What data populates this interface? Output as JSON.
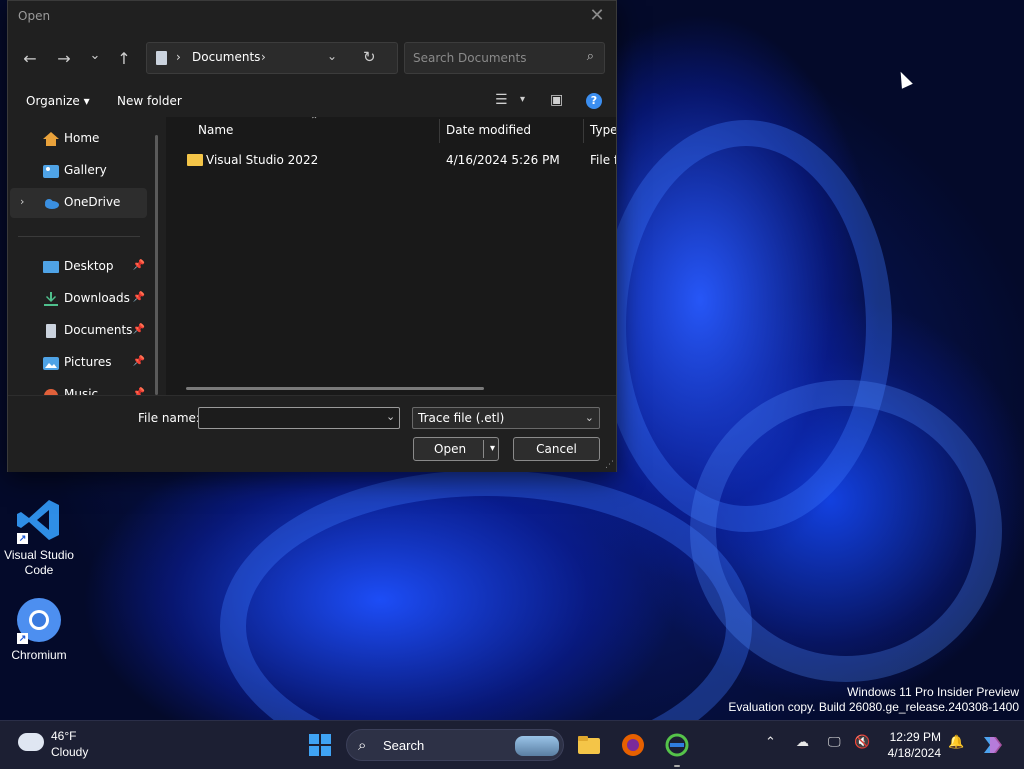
{
  "dialog": {
    "title": "Open",
    "close_glyph": "✕",
    "nav": {
      "back_glyph": "←",
      "forward_glyph": "→",
      "recent_glyph": "⌄",
      "up_glyph": "↑"
    },
    "address": {
      "crumb": "Documents",
      "sep_glyph": "›",
      "dd_glyph": "⌄",
      "refresh_glyph": "↻"
    },
    "search": {
      "placeholder": "Search Documents",
      "icon_glyph": "⌕"
    },
    "commands": {
      "organize": "Organize ▾",
      "new_folder": "New folder",
      "view_glyph": "☰",
      "view_dd_glyph": "▾",
      "preview_glyph": "▣",
      "help_glyph": "?"
    },
    "nav_pane": {
      "items": [
        {
          "label": "Home",
          "icon": "home-icon",
          "color": "#e9a23b"
        },
        {
          "label": "Gallery",
          "icon": "gallery-icon",
          "color": "#4fa3e6"
        },
        {
          "label": "OneDrive",
          "icon": "cloud-icon",
          "color": "#3a8fe0",
          "selected": true,
          "expand_glyph": "›"
        },
        {
          "label": "Desktop",
          "icon": "desktop-icon",
          "color": "#4fa3e6",
          "pin": "📌"
        },
        {
          "label": "Downloads",
          "icon": "download-icon",
          "color": "#4fc08d",
          "pin": "📌"
        },
        {
          "label": "Documents",
          "icon": "document-icon",
          "color": "#cbd3de",
          "pin": "📌"
        },
        {
          "label": "Pictures",
          "icon": "pictures-icon",
          "color": "#4fa3e6",
          "pin": "📌"
        },
        {
          "label": "Music",
          "icon": "music-icon",
          "color": "#e0603a",
          "pin": "📌"
        }
      ]
    },
    "columns": [
      "Name",
      "Date modified",
      "Type"
    ],
    "sort_glyph": "⌃",
    "files": [
      {
        "name": "Visual Studio 2022",
        "date": "4/16/2024 5:26 PM",
        "type": "File folder"
      }
    ],
    "file_name_label": "File name:",
    "file_name_value": "",
    "file_name_dd_glyph": "⌄",
    "file_type": "Trace file (.etl)",
    "file_type_dd_glyph": "⌄",
    "open_label": "Open",
    "open_dd_glyph": "▾",
    "cancel_label": "Cancel",
    "grip_glyph": "⋰"
  },
  "desktop": {
    "icons": [
      {
        "label": "Visual Studio Code",
        "shortcut_glyph": "↗"
      },
      {
        "label": "Chromium",
        "shortcut_glyph": "↗"
      }
    ],
    "watermark": [
      "Windows 11 Pro Insider Preview",
      "Evaluation copy. Build 26080.ge_release.240308-1400"
    ]
  },
  "taskbar": {
    "weather": {
      "temp": "46°F",
      "condition": "Cloudy"
    },
    "search": {
      "label": "Search",
      "icon_glyph": "⌕"
    },
    "tray_glyphs": {
      "overflow": "⌃",
      "onedrive": "☁",
      "network": "🖵",
      "volume": "🔇",
      "notifications": "🔔"
    },
    "clock": {
      "time": "12:29 PM",
      "date": "4/18/2024"
    },
    "colors": {
      "accent": "#3fa3f5"
    }
  }
}
